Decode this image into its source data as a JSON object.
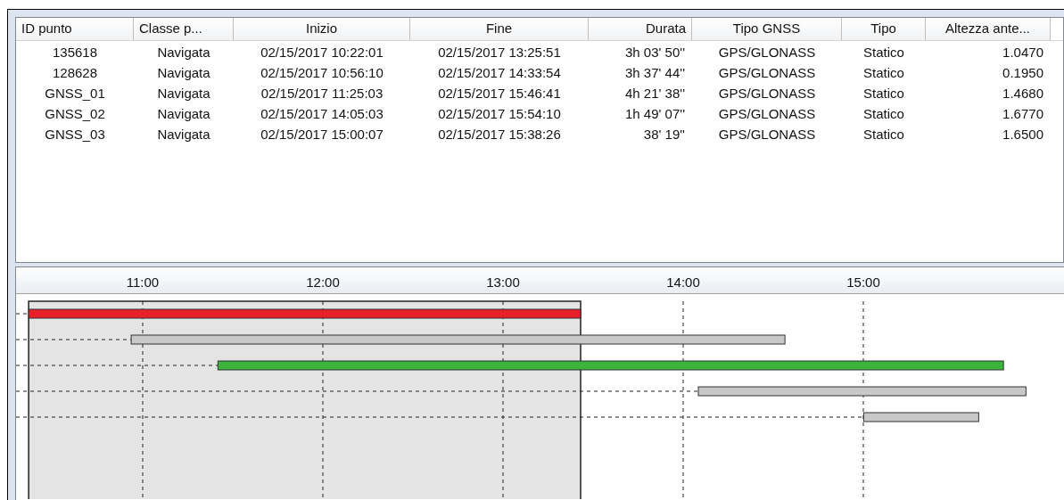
{
  "table": {
    "columns": [
      "ID punto",
      "Classe p...",
      "Inizio",
      "Fine",
      "Durata",
      "Tipo GNSS",
      "Tipo",
      "Altezza ante..."
    ],
    "rows": [
      [
        "135618",
        "Navigata",
        "02/15/2017 10:22:01",
        "02/15/2017 13:25:51",
        "3h 03' 50''",
        "GPS/GLONASS",
        "Statico",
        "1.0470"
      ],
      [
        "128628",
        "Navigata",
        "02/15/2017 10:56:10",
        "02/15/2017 14:33:54",
        "3h 37' 44''",
        "GPS/GLONASS",
        "Statico",
        "0.1950"
      ],
      [
        "GNSS_01",
        "Navigata",
        "02/15/2017 11:25:03",
        "02/15/2017 15:46:41",
        "4h 21' 38''",
        "GPS/GLONASS",
        "Statico",
        "1.4680"
      ],
      [
        "GNSS_02",
        "Navigata",
        "02/15/2017 14:05:03",
        "02/15/2017 15:54:10",
        "1h 49' 07''",
        "GPS/GLONASS",
        "Statico",
        "1.6770"
      ],
      [
        "GNSS_03",
        "Navigata",
        "02/15/2017 15:00:07",
        "02/15/2017 15:38:26",
        "38' 19''",
        "GPS/GLONASS",
        "Statico",
        "1.6500"
      ]
    ]
  },
  "timeline": {
    "ticks": [
      "11:00",
      "12:00",
      "13:00",
      "14:00",
      "15:00"
    ],
    "bars": [
      {
        "color": "#e8202a",
        "selected": true
      },
      {
        "color": "#c8c8c8",
        "selected": false
      },
      {
        "color": "#3cb43c",
        "selected": false
      },
      {
        "color": "#c8c8c8",
        "selected": false
      },
      {
        "color": "#c8c8c8",
        "selected": false
      }
    ]
  }
}
